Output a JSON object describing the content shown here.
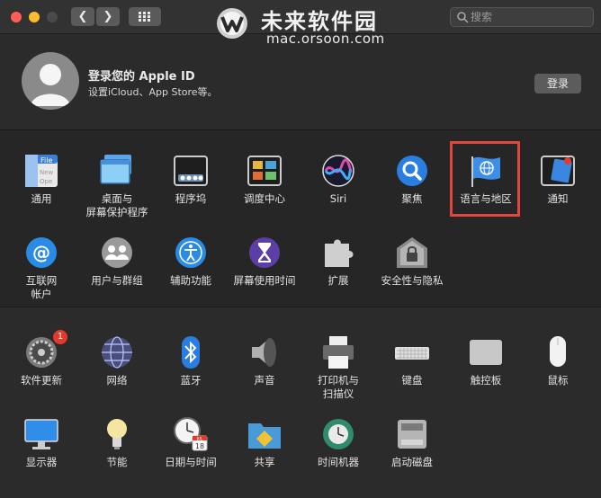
{
  "search": {
    "placeholder": "搜索"
  },
  "watermark": {
    "title": "未来软件园",
    "url": "mac.orsoon.com"
  },
  "account": {
    "title": "登录您的 Apple ID",
    "subtitle": "设置iCloud、App Store等。",
    "login_label": "登录"
  },
  "colors": {
    "highlight": "#e0473c",
    "badge": "#e5392e"
  },
  "panes_row1": [
    {
      "label": "通用",
      "icon": "general-icon"
    },
    {
      "label": "桌面与\n屏幕保护程序",
      "icon": "desktop-screensaver-icon"
    },
    {
      "label": "程序坞",
      "icon": "dock-icon"
    },
    {
      "label": "调度中心",
      "icon": "mission-control-icon"
    },
    {
      "label": "Siri",
      "icon": "siri-icon"
    },
    {
      "label": "聚焦",
      "icon": "spotlight-icon"
    },
    {
      "label": "语言与地区",
      "icon": "language-region-icon"
    },
    {
      "label": "通知",
      "icon": "notifications-icon"
    }
  ],
  "panes_row2": [
    {
      "label": "互联网\n帐户",
      "icon": "internet-accounts-icon"
    },
    {
      "label": "用户与群组",
      "icon": "users-groups-icon"
    },
    {
      "label": "辅助功能",
      "icon": "accessibility-icon"
    },
    {
      "label": "屏幕使用时间",
      "icon": "screen-time-icon"
    },
    {
      "label": "扩展",
      "icon": "extensions-icon"
    },
    {
      "label": "安全性与隐私",
      "icon": "security-privacy-icon"
    }
  ],
  "panes_row3": [
    {
      "label": "软件更新",
      "icon": "software-update-icon",
      "badge": "1"
    },
    {
      "label": "网络",
      "icon": "network-icon"
    },
    {
      "label": "蓝牙",
      "icon": "bluetooth-icon"
    },
    {
      "label": "声音",
      "icon": "sound-icon"
    },
    {
      "label": "打印机与\n扫描仪",
      "icon": "printers-scanners-icon"
    },
    {
      "label": "键盘",
      "icon": "keyboard-icon"
    },
    {
      "label": "触控板",
      "icon": "trackpad-icon"
    },
    {
      "label": "鼠标",
      "icon": "mouse-icon"
    }
  ],
  "panes_row4": [
    {
      "label": "显示器",
      "icon": "displays-icon"
    },
    {
      "label": "节能",
      "icon": "energy-saver-icon"
    },
    {
      "label": "日期与时间",
      "icon": "date-time-icon",
      "calendar_month": "JUL",
      "calendar_day": "18"
    },
    {
      "label": "共享",
      "icon": "sharing-icon"
    },
    {
      "label": "时间机器",
      "icon": "time-machine-icon"
    },
    {
      "label": "启动磁盘",
      "icon": "startup-disk-icon"
    }
  ]
}
